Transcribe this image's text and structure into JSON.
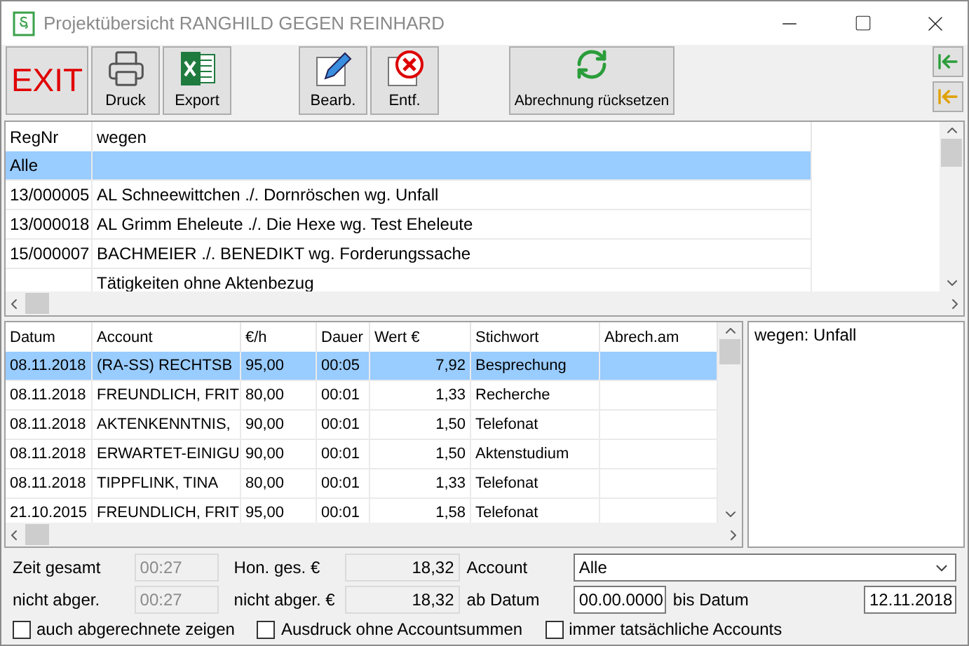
{
  "window": {
    "title": "Projektübersicht RANGHILD GEGEN REINHARD"
  },
  "toolbar": {
    "buttons": [
      {
        "kind": "exit",
        "label": "EXIT"
      },
      {
        "kind": "print",
        "label": "Druck"
      },
      {
        "kind": "excel",
        "label": "Export"
      },
      {
        "kind": "edit",
        "label": "Bearb."
      },
      {
        "kind": "delete",
        "label": "Entf."
      },
      {
        "kind": "reset",
        "label": "Abrechnung rücksetzen"
      }
    ]
  },
  "projects": {
    "columns": [
      "RegNr",
      "wegen"
    ],
    "rows": [
      {
        "cells": [
          "Alle",
          ""
        ],
        "selected": true
      },
      {
        "cells": [
          "13/000005",
          "AL Schneewittchen ./. Dornröschen wg. Unfall"
        ],
        "selected": false
      },
      {
        "cells": [
          "13/000018",
          "AL Grimm Eheleute ./. Die Hexe wg. Test Eheleute"
        ],
        "selected": false
      },
      {
        "cells": [
          "15/000007",
          " BACHMEIER ./. BENEDIKT wg. Forderungssache"
        ],
        "selected": false
      },
      {
        "cells": [
          "",
          "Tätigkeiten ohne Aktenbezug"
        ],
        "selected": false
      }
    ]
  },
  "activities": {
    "columns": [
      "Datum",
      "Account",
      "€/h",
      "Dauer",
      "Wert €",
      "Stichwort",
      "Abrech.am"
    ],
    "rows": [
      {
        "cells": [
          "08.11.2018",
          "(RA-SS) RECHTSB",
          "95,00",
          "00:05",
          "7,92",
          "Besprechung",
          ""
        ],
        "selected": true
      },
      {
        "cells": [
          "08.11.2018",
          "FREUNDLICH, FRIT",
          "80,00",
          "00:01",
          "1,33",
          "Recherche",
          ""
        ],
        "selected": false
      },
      {
        "cells": [
          "08.11.2018",
          "AKTENKENNTNIS,",
          "90,00",
          "00:01",
          "1,50",
          "Telefonat",
          ""
        ],
        "selected": false
      },
      {
        "cells": [
          "08.11.2018",
          "ERWARTET-EINIGU",
          "90,00",
          "00:01",
          "1,50",
          "Aktenstudium",
          ""
        ],
        "selected": false
      },
      {
        "cells": [
          "08.11.2018",
          "TIPPFLINK, TINA",
          "80,00",
          "00:01",
          "1,33",
          "Telefonat",
          ""
        ],
        "selected": false
      },
      {
        "cells": [
          "21.10.2015",
          "FREUNDLICH, FRIT",
          "95,00",
          "00:01",
          "1,58",
          "Telefonat",
          ""
        ],
        "selected": false
      }
    ]
  },
  "detail": {
    "text": "wegen: Unfall"
  },
  "summary": {
    "zeit_gesamt": {
      "label": "Zeit gesamt",
      "value": "00:27",
      "disabled": true
    },
    "zeit_nicht_abger": {
      "label": "nicht abger.",
      "value": "00:27",
      "disabled": true
    },
    "hon_ges": {
      "label": "Hon. ges. €",
      "value": "18,32"
    },
    "hon_nicht_abger": {
      "label": "nicht abger. €",
      "value": "18,32"
    },
    "account": {
      "label": "Account",
      "value": "Alle"
    },
    "ab_datum": {
      "label": "ab Datum",
      "value": "00.00.0000"
    },
    "bis_datum": {
      "label": "bis Datum",
      "value": "12.11.2018"
    }
  },
  "options": [
    {
      "label": "auch abgerechnete zeigen",
      "checked": false
    },
    {
      "label": "Ausdruck ohne Accountsummen",
      "checked": false
    },
    {
      "label": "immer tatsächliche Accounts",
      "checked": false
    }
  ]
}
